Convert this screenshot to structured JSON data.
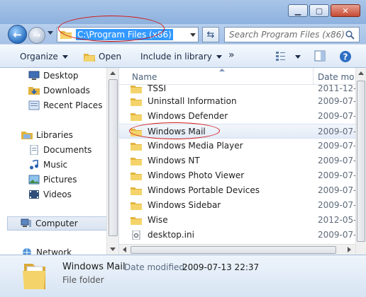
{
  "window": {
    "minimize_glyph": "▁",
    "maximize_glyph": "▢",
    "close_glyph": "✕"
  },
  "address": {
    "path": "C:\\Program Files (x86)",
    "search_placeholder": "Search Program Files (x86)"
  },
  "toolbar": {
    "organize": "Organize",
    "open": "Open",
    "include_in_library": "Include in library",
    "more": "»"
  },
  "nav": {
    "items": [
      {
        "label": "Desktop",
        "icon": "desktop-icon"
      },
      {
        "label": "Downloads",
        "icon": "downloads-icon"
      },
      {
        "label": "Recent Places",
        "icon": "recent-places-icon"
      },
      {
        "label": "Libraries",
        "icon": "libraries-icon"
      },
      {
        "label": "Documents",
        "icon": "documents-icon"
      },
      {
        "label": "Music",
        "icon": "music-icon"
      },
      {
        "label": "Pictures",
        "icon": "pictures-icon"
      },
      {
        "label": "Videos",
        "icon": "videos-icon"
      },
      {
        "label": "Computer",
        "icon": "computer-icon"
      },
      {
        "label": "Network",
        "icon": "network-icon"
      }
    ]
  },
  "filelist": {
    "col_name": "Name",
    "col_date": "Date mo",
    "rows": [
      {
        "name": "TSSI",
        "date": "2011-12-"
      },
      {
        "name": "Uninstall Information",
        "date": "2009-07-"
      },
      {
        "name": "Windows Defender",
        "date": "2009-07-"
      },
      {
        "name": "Windows Mail",
        "date": "2009-07-"
      },
      {
        "name": "Windows Media Player",
        "date": "2009-07-"
      },
      {
        "name": "Windows NT",
        "date": "2009-07-"
      },
      {
        "name": "Windows Photo Viewer",
        "date": "2009-07-"
      },
      {
        "name": "Windows Portable Devices",
        "date": "2009-07-"
      },
      {
        "name": "Windows Sidebar",
        "date": "2009-07-"
      },
      {
        "name": "Wise",
        "date": "2012-05-"
      },
      {
        "name": "desktop.ini",
        "date": "2009-07-"
      }
    ]
  },
  "details": {
    "name": "Windows Mail",
    "type": "File folder",
    "date_label": "Date modified:",
    "date_value": "2009-07-13 22:37"
  },
  "colors": {
    "highlight": "#3399ff",
    "annotation": "#d21919",
    "folder": "#f2cf5b"
  }
}
